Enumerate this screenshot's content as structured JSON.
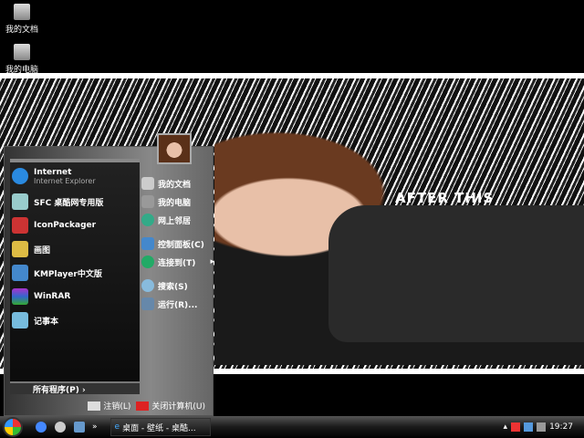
{
  "desktop": {
    "icons": [
      {
        "label": "我的文档"
      },
      {
        "label": "我的电脑"
      }
    ],
    "wallpaper_text": "AFTER THIS"
  },
  "start_menu": {
    "pinned": [
      {
        "label": "Internet",
        "sub": "Internet Explorer"
      },
      {
        "label": "SFC 桌酷网专用版"
      },
      {
        "label": "IconPackager"
      },
      {
        "label": "画图"
      },
      {
        "label": "KMPlayer中文版"
      },
      {
        "label": "WinRAR"
      },
      {
        "label": "记事本"
      }
    ],
    "all_programs": "所有程序(P)",
    "places": [
      {
        "label": "我的文档"
      },
      {
        "label": "我的电脑"
      },
      {
        "label": "网上邻居"
      },
      {
        "label": "控制面板(C)"
      },
      {
        "label": "连接到(T)"
      },
      {
        "label": "搜索(S)"
      },
      {
        "label": "运行(R)..."
      }
    ],
    "logoff": "注销(L)",
    "shutdown": "关闭计算机(U)"
  },
  "taskbar": {
    "overflow": "»",
    "task": "桌面 - 壁纸 - 桌酷...",
    "clock": "19:27",
    "tray_chevron": "▴"
  }
}
